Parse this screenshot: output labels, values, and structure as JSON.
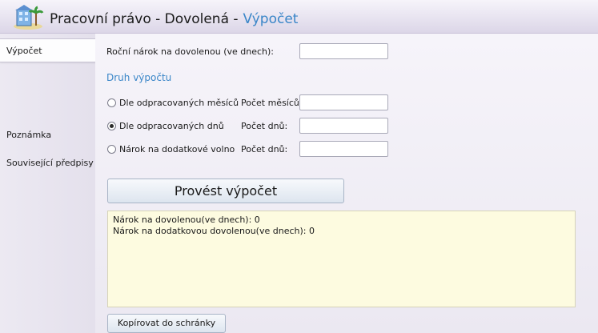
{
  "header": {
    "title": "Pracovní právo - Dovolená -",
    "subtitle": "Výpočet",
    "icon": "beach-building-icon"
  },
  "sidebar": {
    "items": [
      {
        "label": "Výpočet",
        "active": true
      },
      {
        "label": "Poznámka",
        "active": false
      },
      {
        "label": "Související předpisy",
        "active": false
      }
    ]
  },
  "form": {
    "annual_label": "Roční nárok na dovolenou (ve dnech):",
    "annual_value": "",
    "section_title": "Druh výpočtu",
    "options": [
      {
        "label": "Dle odpracovaných měsíců",
        "field_label": "Počet měsíců:",
        "value": "",
        "checked": false
      },
      {
        "label": "Dle odpracovaných dnů",
        "field_label": "Počet dnů:",
        "value": "",
        "checked": true
      },
      {
        "label": "Nárok na dodatkové volno",
        "field_label": "Počet dnů:",
        "value": "",
        "checked": false
      }
    ],
    "calculate_label": "Provést výpočet"
  },
  "result": {
    "lines": [
      "Nárok na dovolenou(ve dnech): 0",
      "Nárok na dodatkovou dovolenou(ve dnech): 0"
    ]
  },
  "copy_label": "Kopírovat do schránky",
  "colors": {
    "accent": "#3a86c8",
    "result_bg": "#fdfbe0",
    "background": "#f0eef5"
  }
}
